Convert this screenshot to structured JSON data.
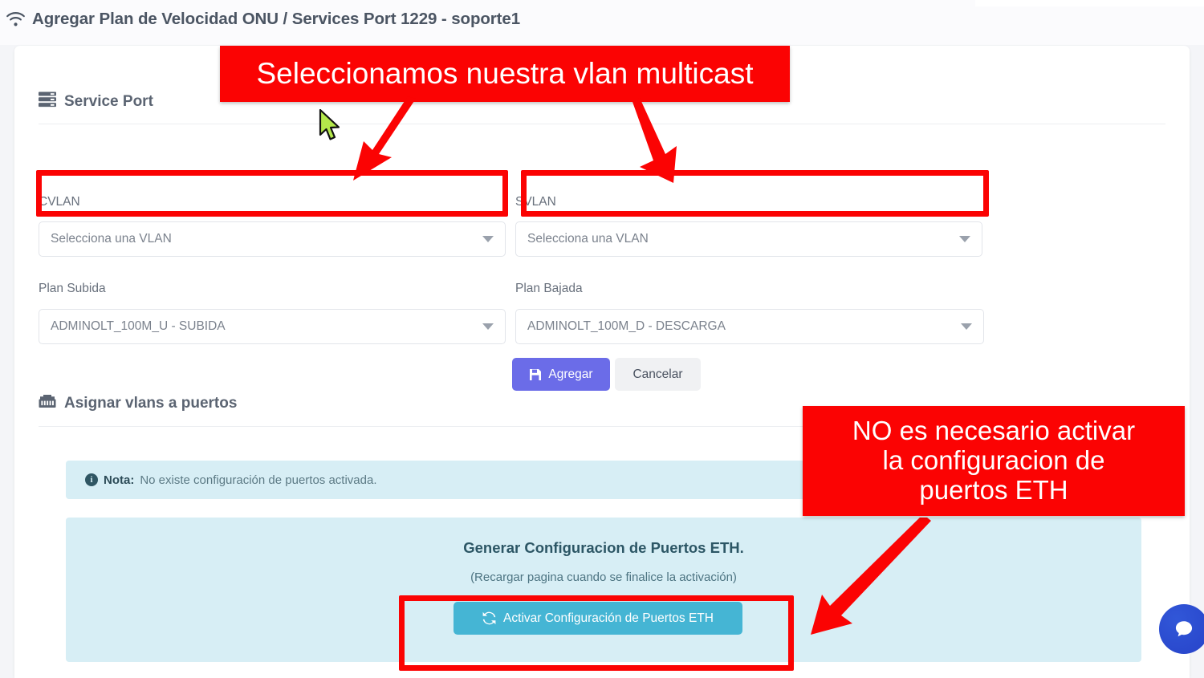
{
  "page": {
    "title": "Agregar Plan de Velocidad ONU / Services Port 1229 - soporte1",
    "wifi_icon": "wifi-icon"
  },
  "service_port": {
    "heading": "Service Port",
    "heading_icon": "server-stack-icon",
    "fields": {
      "cvlan_label": "CVLAN",
      "cvlan_value": "Selecciona una VLAN",
      "svlan_label": "SVLAN",
      "svlan_value": "Selecciona una VLAN",
      "plan_subida_label": "Plan Subida",
      "plan_subida_value": "ADMINOLT_100M_U - SUBIDA",
      "plan_bajada_label": "Plan Bajada",
      "plan_bajada_value": "ADMINOLT_100M_D - DESCARGA"
    },
    "buttons": {
      "agregar": "Agregar",
      "agregar_icon": "save-icon",
      "cancelar": "Cancelar"
    }
  },
  "vlan_ports": {
    "heading": "Asignar vlans a puertos",
    "heading_icon": "ethernet-port-icon",
    "note": {
      "icon": "info-circle-icon",
      "label": "Nota:",
      "text": " No existe configuración de puertos activada."
    },
    "generate_panel": {
      "title": "Generar Configuracion de Puertos ETH.",
      "subtitle": "(Recargar pagina cuando se finalice la activación)",
      "button_label": "Activar Configuración de Puertos ETH",
      "button_icon": "sync-refresh-icon"
    }
  },
  "annotations": {
    "top_note": "Seleccionamos nuestra vlan multicast",
    "right_note_lines": [
      "NO es necesario activar",
      "la configuracion de",
      "puertos ETH"
    ]
  },
  "chat": {
    "icon": "chat-bubble-icon"
  },
  "colors": {
    "annotation_red": "#fb0303",
    "primary_purple": "#6b6ce8",
    "info_cyan": "#45b5d4",
    "panel_blue": "#d7eef5",
    "chat_blue": "#2743c9"
  }
}
